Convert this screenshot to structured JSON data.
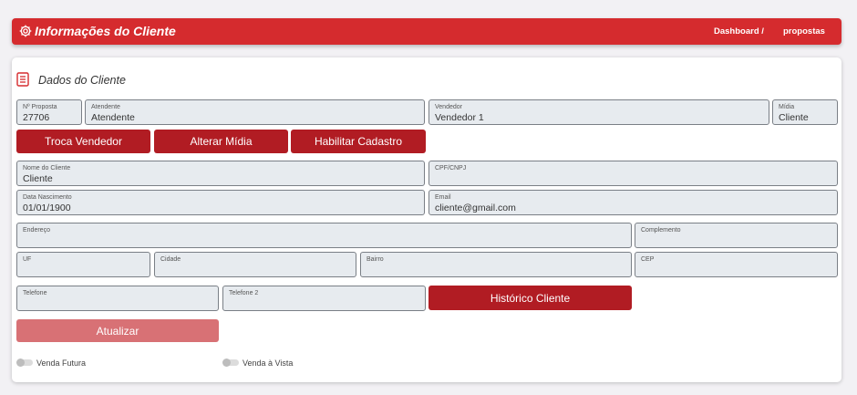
{
  "header": {
    "title": "Informações do Cliente",
    "breadcrumb": [
      "Dashboard /",
      "propostas"
    ]
  },
  "section": {
    "title": "Dados do Cliente"
  },
  "fields": {
    "proposta": {
      "label": "Nº Proposta",
      "value": "27706"
    },
    "atendente": {
      "label": "Atendente",
      "value": "Atendente"
    },
    "vendedor": {
      "label": "Vendedor",
      "value": "Vendedor 1"
    },
    "midia": {
      "label": "Mídia",
      "value": "Cliente"
    },
    "nome": {
      "label": "Nome do Cliente",
      "value": "Cliente"
    },
    "cpf": {
      "label": "CPF/CNPJ",
      "value": ""
    },
    "nascimento": {
      "label": "Data Nascimento",
      "value": "01/01/1900"
    },
    "email": {
      "label": "Email",
      "value": "cliente@gmail.com"
    },
    "endereco": {
      "label": "Endereço",
      "value": ""
    },
    "complemento": {
      "label": "Complemento",
      "value": ""
    },
    "uf": {
      "label": "UF",
      "value": ""
    },
    "cidade": {
      "label": "Cidade",
      "value": ""
    },
    "bairro": {
      "label": "Bairro",
      "value": ""
    },
    "cep": {
      "label": "CEP",
      "value": ""
    },
    "telefone": {
      "label": "Telefone",
      "value": ""
    },
    "telefone2": {
      "label": "Telefone 2",
      "value": ""
    }
  },
  "buttons": {
    "troca_vendedor": "Troca Vendedor",
    "alterar_midia": "Alterar Mídia",
    "habilitar_cadastro": "Habilitar Cadastro",
    "historico_cliente": "Histórico Cliente",
    "atualizar": "Atualizar"
  },
  "toggles": {
    "venda_futura": {
      "label": "Venda Futura",
      "checked": false
    },
    "venda_vista": {
      "label": "Venda à Vista",
      "checked": false
    }
  },
  "icons": {
    "header": "gear-icon",
    "section": "document-list-icon"
  },
  "colors": {
    "header_bg": "#d52b2e",
    "button_bg": "#b11c23",
    "button_disabled_bg": "#d87175",
    "field_bg": "#e7ebef",
    "page_bg": "#f2f1f4"
  }
}
